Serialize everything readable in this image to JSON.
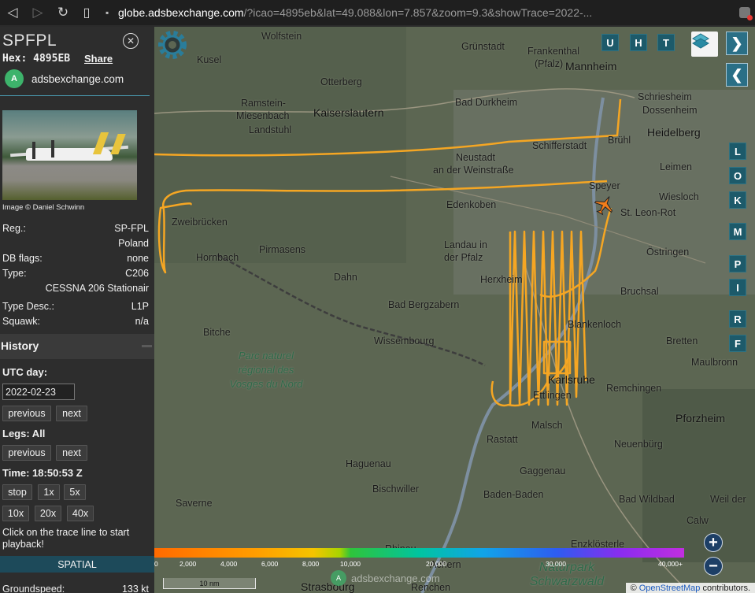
{
  "browser": {
    "url_host": "globe.adsbexchange.com",
    "url_path": "/?icao=4895eb&lat=49.088&lon=7.857&zoom=9.3&showTrace=2022-..."
  },
  "aircraft": {
    "callsign": "SPFPL",
    "hex_label": "Hex:",
    "hex_value": "4895EB",
    "share_label": "Share",
    "brand": "adsbexchange.com",
    "photo_credit": "Image © Daniel Schwinn",
    "details": [
      {
        "label": "Reg.:",
        "value": "SP-FPL"
      },
      {
        "label": "",
        "value": "Poland"
      },
      {
        "label": "DB flags:",
        "value": "none"
      },
      {
        "label": "Type:",
        "value": "C206"
      },
      {
        "label": "",
        "value": "CESSNA 206 Stationair"
      },
      {
        "label": "Type Desc.:",
        "value": "L1P"
      },
      {
        "label": "Squawk:",
        "value": "n/a"
      }
    ]
  },
  "history": {
    "title": "History",
    "utc_day_label": "UTC day:",
    "date_value": "2022-02-23",
    "previous_label": "previous",
    "next_label": "next",
    "legs_label": "Legs: All",
    "time_label": "Time: 18:50:53 Z",
    "stop_label": "stop",
    "speed_1x": "1x",
    "speed_5x": "5x",
    "speed_10x": "10x",
    "speed_20x": "20x",
    "speed_40x": "40x",
    "playback_hint": "Click on the trace line to start playback!",
    "spatial_label": "SPATIAL",
    "groundspeed_label": "Groundspeed:",
    "groundspeed_value": "133 kt"
  },
  "map": {
    "toggle_buttons": [
      "U",
      "H",
      "T"
    ],
    "side_buttons": [
      "L",
      "O",
      "K",
      "M",
      "P",
      "I",
      "R",
      "F"
    ],
    "labels": [
      {
        "text": "Wolfstein"
      },
      {
        "text": "Grünstadt"
      },
      {
        "text": "Frankenthal"
      },
      {
        "text": "(Pfalz)"
      },
      {
        "text": "Kusel"
      },
      {
        "text": "Otterberg"
      },
      {
        "text": "Mannheim"
      },
      {
        "text": "Ramstein-"
      },
      {
        "text": "Miesenbach"
      },
      {
        "text": "Kaiserslautern"
      },
      {
        "text": "Bad Durkheim"
      },
      {
        "text": "Schriesheim"
      },
      {
        "text": "Dossenheim"
      },
      {
        "text": "Heidelberg"
      },
      {
        "text": "Landstuhl"
      },
      {
        "text": "Schifferstadt"
      },
      {
        "text": "Brühl"
      },
      {
        "text": "Neustadt"
      },
      {
        "text": "an der Weinstraße"
      },
      {
        "text": "Leimen"
      },
      {
        "text": "Speyer"
      },
      {
        "text": "Wiesloch"
      },
      {
        "text": "Edenkoben"
      },
      {
        "text": "St. Leon-Rot"
      },
      {
        "text": "Zweibrücken"
      },
      {
        "text": "Hornbach"
      },
      {
        "text": "Pirmasens"
      },
      {
        "text": "Landau in"
      },
      {
        "text": "der Pfalz"
      },
      {
        "text": "Östringen"
      },
      {
        "text": "Dahn"
      },
      {
        "text": "Herxheim"
      },
      {
        "text": "Bruchsal"
      },
      {
        "text": "Bad Bergzabern"
      },
      {
        "text": "Blankenloch"
      },
      {
        "text": "Bitche"
      },
      {
        "text": "Wissembourg"
      },
      {
        "text": "Bretten"
      },
      {
        "text": "Karlsruhe"
      },
      {
        "text": "Maulbronn"
      },
      {
        "text": "Ettlingen"
      },
      {
        "text": "Remchingen"
      },
      {
        "text": "Pforzheim"
      },
      {
        "text": "Malsch"
      },
      {
        "text": "Rastatt"
      },
      {
        "text": "Neuenbürg"
      },
      {
        "text": "Haguenau"
      },
      {
        "text": "Gaggenau"
      },
      {
        "text": "Bischwiller"
      },
      {
        "text": "Baden-Baden"
      },
      {
        "text": "Bad Wildbad"
      },
      {
        "text": "Weil der"
      },
      {
        "text": "Saverne"
      },
      {
        "text": "Calw"
      },
      {
        "text": "Enzklösterle"
      },
      {
        "text": "Rhinau"
      },
      {
        "text": "Achern"
      },
      {
        "text": "Strasbourg"
      },
      {
        "text": "Renchen"
      }
    ],
    "park_label_1": "Parc naturel régional des Vosges du Nord",
    "park_label_2": "Naturpark Schwarzwald",
    "altitude_ticks": [
      "0",
      "2,000",
      "4,000",
      "6,000",
      "8,000",
      "10,000",
      "20,000",
      "30,000",
      "40,000+"
    ],
    "scale_label": "10 nm",
    "watermark": "adsbexchange.com",
    "attribution_prefix": "©",
    "attribution_link": "OpenStreetMap",
    "attribution_suffix": "contributors."
  },
  "colors": {
    "trace": "#f5a623",
    "button_teal": "#1d5a6a",
    "spatial_bar": "#1d4a5a"
  }
}
